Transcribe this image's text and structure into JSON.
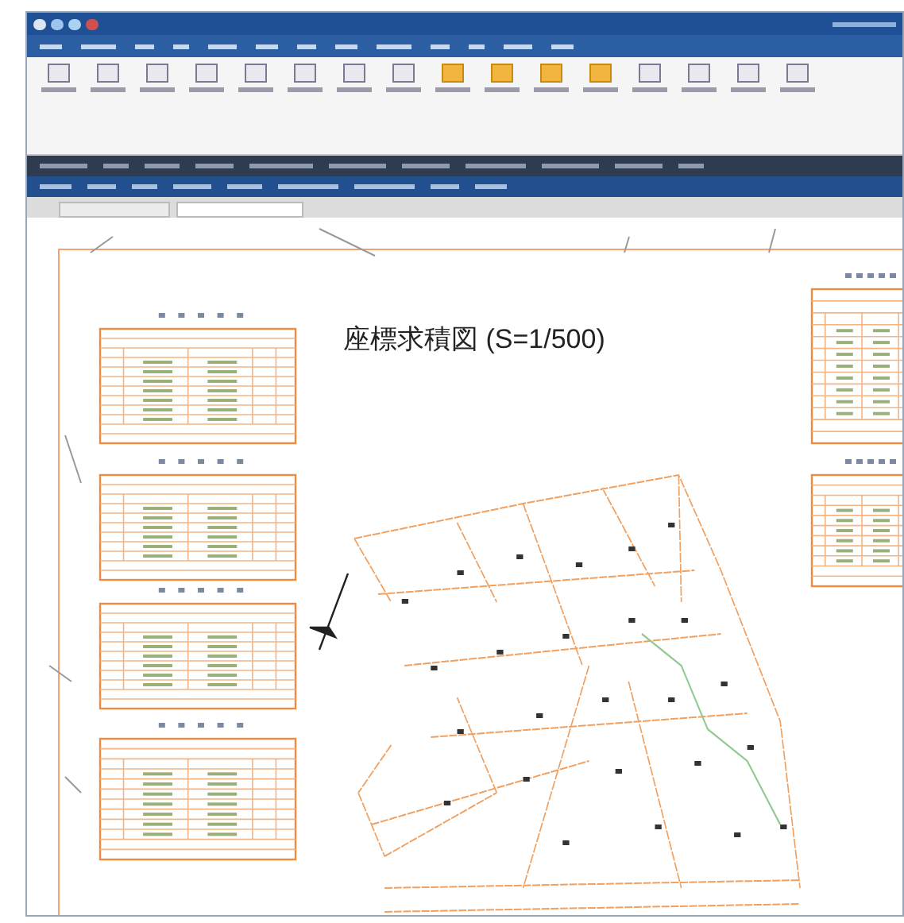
{
  "drawing": {
    "title": "座標求積図 (S=1/500)"
  }
}
